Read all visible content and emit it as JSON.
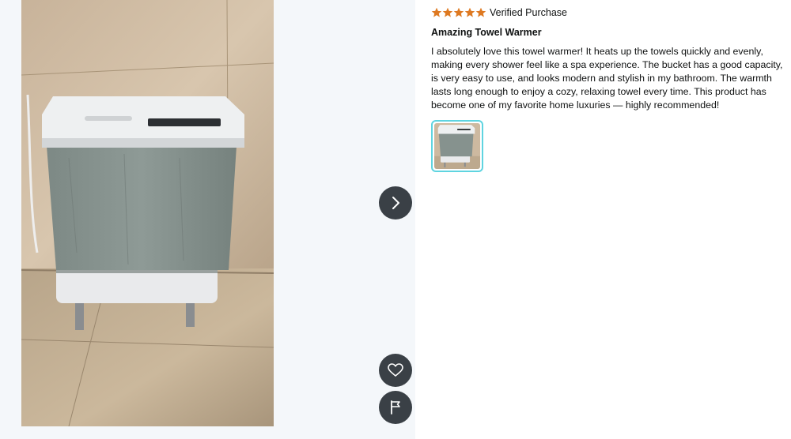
{
  "viewer": {
    "photo_subject": "towel warmer bucket in bathroom",
    "next_icon": "chevron-right-icon",
    "like_icon": "heart-icon",
    "report_icon": "flag-icon",
    "button_color": "#3a4046"
  },
  "review": {
    "rating": 5,
    "rating_max": 5,
    "star_color": "#de7921",
    "verified_label": "Verified Purchase",
    "title": "Amazing Towel Warmer",
    "body": "I absolutely love this towel warmer! It heats up the towels quickly and evenly, making every shower feel like a spa experience. The bucket has a good capacity, is very easy to use, and looks modern and stylish in my bathroom. The warmth lasts long enough to enjoy a cozy, relaxing towel every time. This product has become one of my favorite home luxuries — highly recommended!",
    "thumbnail_border_color": "#5fd4e0"
  }
}
